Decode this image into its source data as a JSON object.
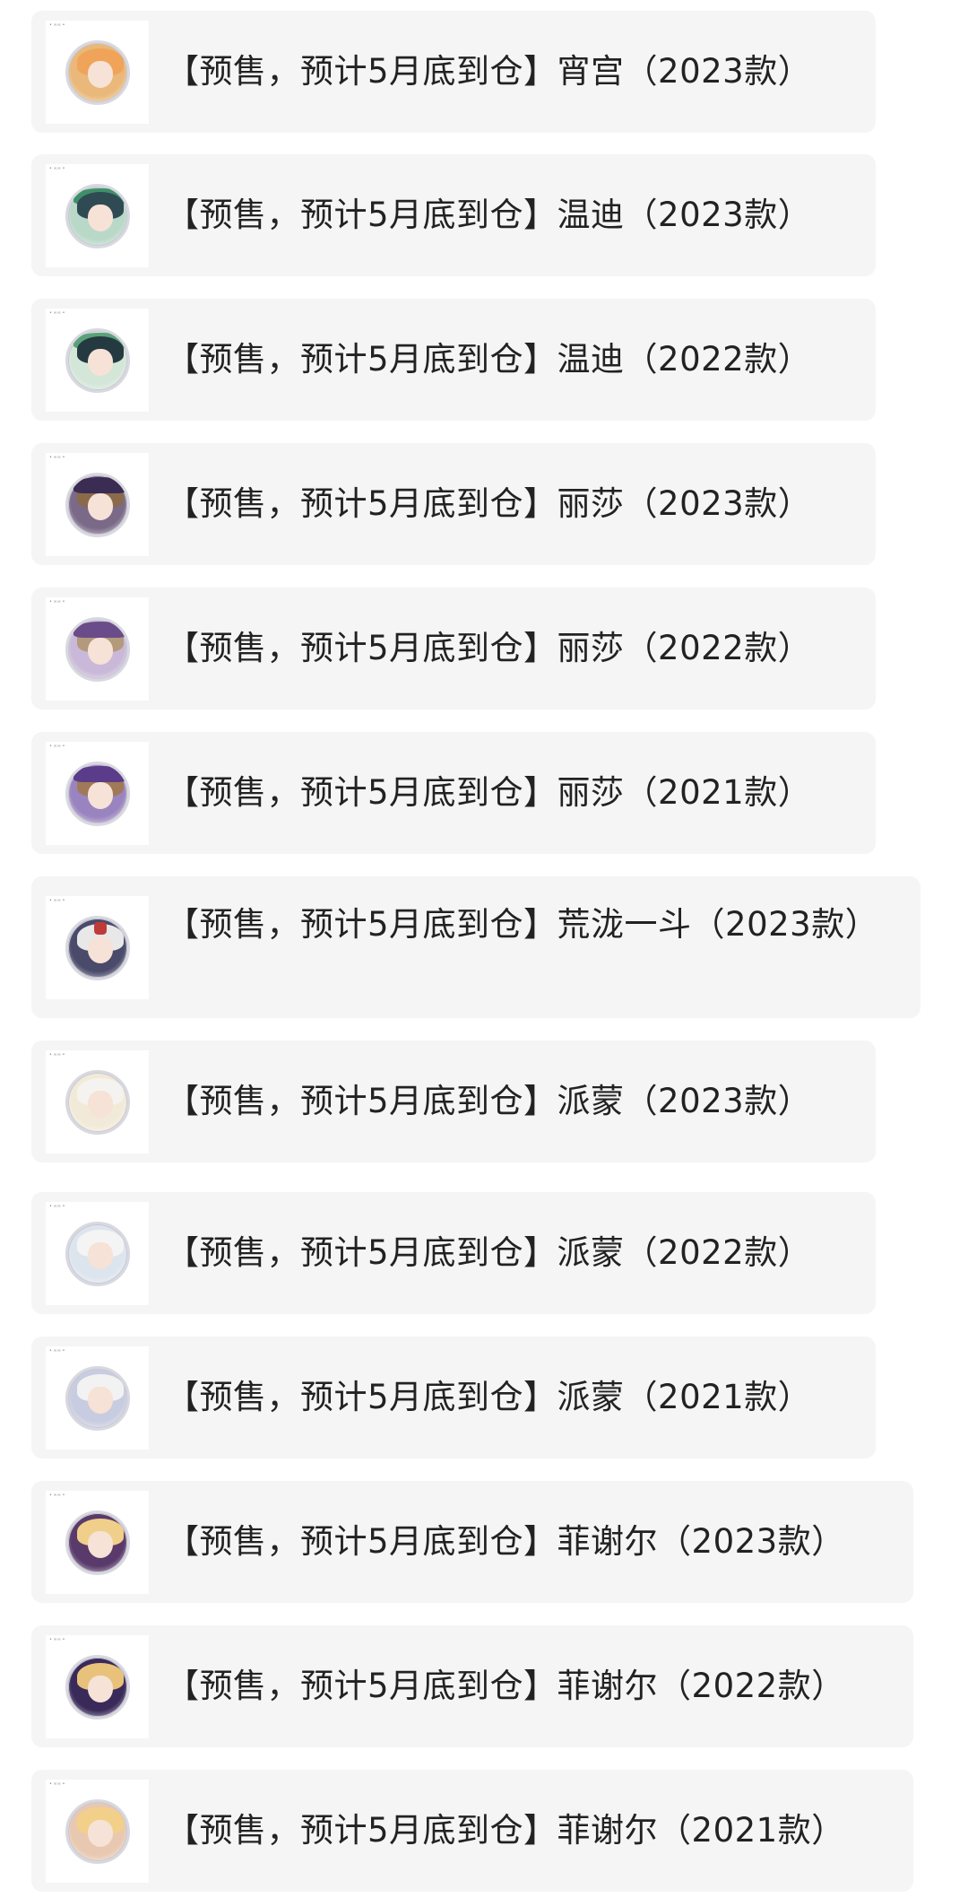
{
  "items": [
    {
      "title": "【预售，预计5月底到仓】宵宫（2023款）",
      "thumb_tag": "• ∞∞ •",
      "image": "yoimiya-badge-2023",
      "colors": {
        "bg": "#e9b87a",
        "hair": "#f0a45a",
        "hat": "#d9774a"
      }
    },
    {
      "title": "【预售，预计5月底到仓】温迪（2023款）",
      "thumb_tag": "• ∞∞ •",
      "image": "venti-badge-2023",
      "colors": {
        "bg": "#b9d8c8",
        "hair": "#2f4a52",
        "hat": "#3f8f6a"
      }
    },
    {
      "title": "【预售，预计5月底到仓】温迪（2022款）",
      "thumb_tag": "• ∞∞ •",
      "image": "venti-badge-2022",
      "colors": {
        "bg": "#d3e6d8",
        "hair": "#253a40",
        "hat": "#5aa27a"
      }
    },
    {
      "title": "【预售，预计5月底到仓】丽莎（2023款）",
      "thumb_tag": "• ∞∞ •",
      "image": "lisa-badge-2023",
      "colors": {
        "bg": "#7a6a88",
        "hair": "#8a6a4a",
        "hat": "#3a2c52"
      }
    },
    {
      "title": "【预售，预计5月底到仓】丽莎（2022款）",
      "thumb_tag": "• ∞∞ •",
      "image": "lisa-badge-2022",
      "colors": {
        "bg": "#c9b8d8",
        "hair": "#b39a7a",
        "hat": "#6a4c8a"
      }
    },
    {
      "title": "【预售，预计5月底到仓】丽莎（2021款）",
      "thumb_tag": "• ∞∞ •",
      "image": "lisa-badge-2021",
      "colors": {
        "bg": "#9a84c0",
        "hair": "#a07a58",
        "hat": "#5a3c8a"
      }
    },
    {
      "title": "【预售，预计5月底到仓】荒泷一斗（2023款）",
      "thumb_tag": "• ∞∞ •",
      "image": "itto-badge-2023",
      "colors": {
        "bg": "#4a4a6a",
        "hair": "#e8e8e8",
        "hat": "#c03a3a"
      }
    },
    {
      "title": "【预售，预计5月底到仓】派蒙（2023款）",
      "thumb_tag": "• ∞∞ •",
      "image": "paimon-badge-2023",
      "colors": {
        "bg": "#f2ead8",
        "hair": "#f5f3ef",
        "hat": "#d8c08a"
      }
    },
    {
      "title": "【预售，预计5月底到仓】派蒙（2022款）",
      "thumb_tag": "• ∞∞ •",
      "image": "paimon-badge-2022",
      "colors": {
        "bg": "#dce4ee",
        "hair": "#f4f4f4",
        "hat": "#8aa2c8"
      }
    },
    {
      "title": "【预售，预计5月底到仓】派蒙（2021款）",
      "thumb_tag": "• ∞∞ •",
      "image": "paimon-badge-2021",
      "colors": {
        "bg": "#c8cce0",
        "hair": "#f2f2f2",
        "hat": "#4a5088"
      }
    },
    {
      "title": "【预售，预计5月底到仓】菲谢尔（2023款）",
      "thumb_tag": "• ∞∞ •",
      "image": "fischl-badge-2023",
      "colors": {
        "bg": "#5a3a6a",
        "hair": "#f0cf8a",
        "hat": "#2a2a3a"
      }
    },
    {
      "title": "【预售，预计5月底到仓】菲谢尔（2022款）",
      "thumb_tag": "• ∞∞ •",
      "image": "fischl-badge-2022",
      "colors": {
        "bg": "#3a2a5a",
        "hair": "#e8c27a",
        "hat": "#6a4a9a"
      }
    },
    {
      "title": "【预售，预计5月底到仓】菲谢尔（2021款）",
      "thumb_tag": "• ∞∞ •",
      "image": "fischl-badge-2021",
      "colors": {
        "bg": "#e8c8b0",
        "hair": "#f2d08a",
        "hat": "#4a2a3a"
      }
    }
  ]
}
